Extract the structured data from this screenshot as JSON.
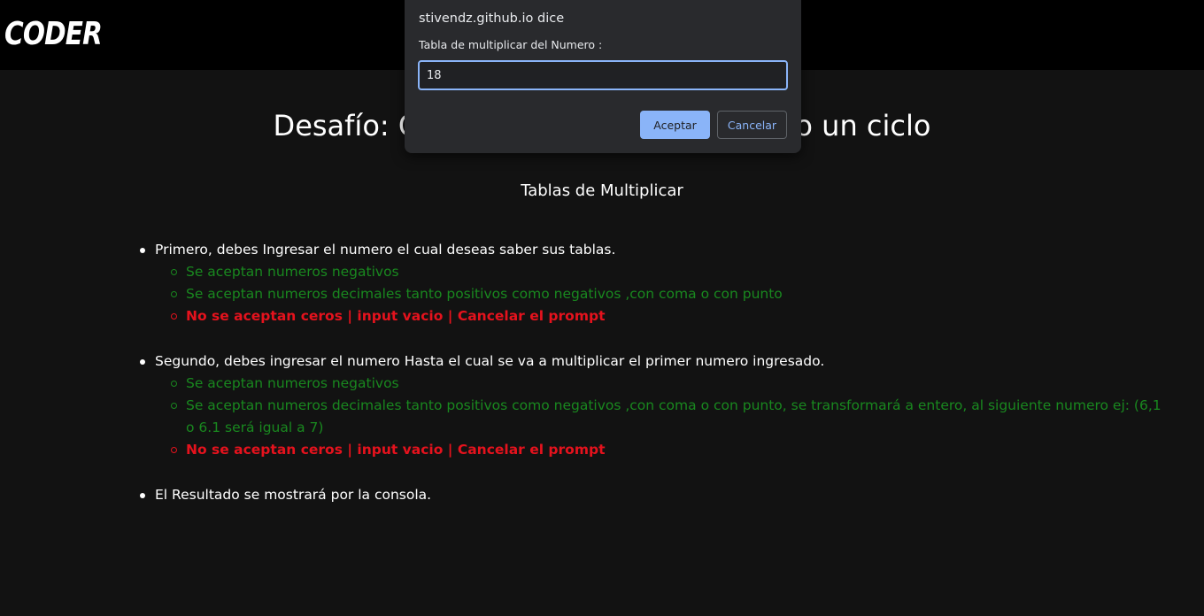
{
  "header": {
    "logo": "CODER"
  },
  "page": {
    "title": "Desafío: Crear un algoritmo utilizando un ciclo",
    "subtitle": "Tablas de Multiplicar"
  },
  "instructions": [
    {
      "text": "Primero, debes Ingresar el numero el cual deseas saber sus tablas.",
      "notes": [
        {
          "text": "Se aceptan numeros negativos",
          "type": "ok"
        },
        {
          "text": "Se aceptan numeros decimales tanto positivos como negativos ,con coma o con punto",
          "type": "ok"
        },
        {
          "text": "No se aceptan ceros | input vacio | Cancelar el prompt",
          "type": "error"
        }
      ]
    },
    {
      "text": "Segundo, debes ingresar el numero Hasta el cual se va a multiplicar el primer numero ingresado.",
      "notes": [
        {
          "text": "Se aceptan numeros negativos",
          "type": "ok"
        },
        {
          "text": "Se aceptan numeros decimales tanto positivos como negativos ,con coma o con punto, se transformará a entero, al siguiente numero ej: (6,1 o 6.1 será igual a 7)",
          "type": "ok"
        },
        {
          "text": "No se aceptan ceros | input vacio | Cancelar el prompt",
          "type": "error"
        }
      ]
    },
    {
      "text": "El Resultado se mostrará por la consola.",
      "notes": []
    }
  ],
  "dialog": {
    "title": "stivendz.github.io dice",
    "message": "Tabla de multiplicar del Numero :",
    "input_value": "18",
    "ok_label": "Aceptar",
    "cancel_label": "Cancelar"
  },
  "colors": {
    "ok_note": "#19881f",
    "error_note": "#e5121d",
    "dialog_accent": "#8ab4f8"
  }
}
